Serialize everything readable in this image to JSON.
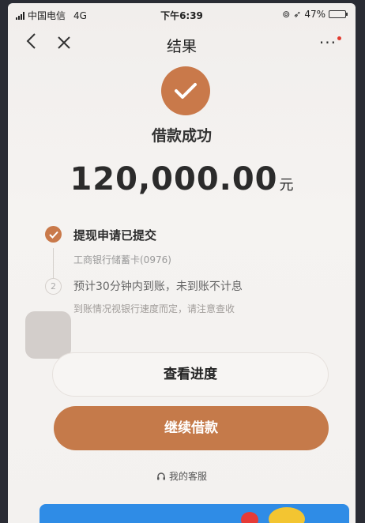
{
  "status_bar": {
    "carrier": "中国电信",
    "network": "4G",
    "time": "下午6:39",
    "battery_percent": "47%",
    "battery_level": 0.47
  },
  "nav": {
    "title": "结果",
    "more": "···"
  },
  "result": {
    "title": "借款成功",
    "amount": "120,000.00",
    "unit": "元"
  },
  "steps": [
    {
      "title": "提现申请已提交",
      "subtitle": "工商银行储蓄卡(0976)"
    },
    {
      "number": "2",
      "title": "预计30分钟内到账，未到账不计息",
      "subtitle": "到账情况视银行速度而定，请注意查收"
    }
  ],
  "buttons": {
    "progress": "查看进度",
    "continue": "继续借款"
  },
  "service": {
    "label": "我的客服"
  },
  "colors": {
    "accent": "#c57a4a",
    "banner": "#2f8ce6"
  },
  "icons": {
    "back": "chevron-left-icon",
    "close": "close-icon",
    "success": "check-circle-icon",
    "service": "headset-icon"
  }
}
